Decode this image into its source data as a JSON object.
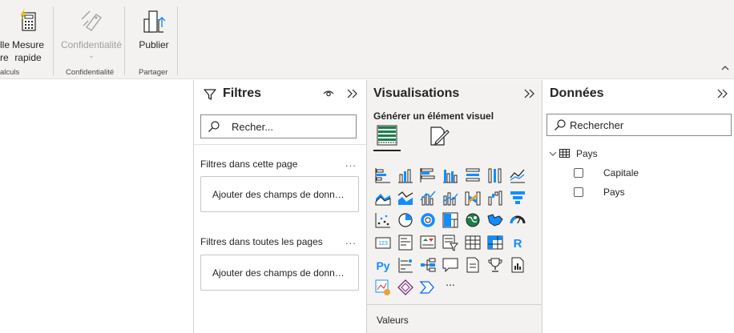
{
  "ribbon": {
    "calc_button_partial_line1": "lle",
    "calc_button_partial_line2": "re",
    "measure_line1": "Mesure",
    "measure_line2": "rapide",
    "calc_group_label": "alculs",
    "confidentiality_button": "Confidentialité",
    "confidentiality_group_label": "Confidentialité",
    "publish_button": "Publier",
    "share_group_label": "Partager"
  },
  "filters": {
    "title": "Filtres",
    "search_placeholder": "Recher...",
    "page_section": "Filtres dans cette page",
    "page_dropzone": "Ajouter des champs de donné...",
    "all_section": "Filtres dans toutes les pages",
    "all_dropzone": "Ajouter des champs de donné...",
    "more_label": "..."
  },
  "visualizations": {
    "title": "Visualisations",
    "subtitle": "Générer un élément visuel",
    "more_label": "...",
    "values_label": "Valeurs",
    "accent_color": "#118dff"
  },
  "data": {
    "title": "Données",
    "search_placeholder": "Rechercher",
    "table_name": "Pays",
    "fields": [
      "Capitale",
      "Pays"
    ]
  }
}
